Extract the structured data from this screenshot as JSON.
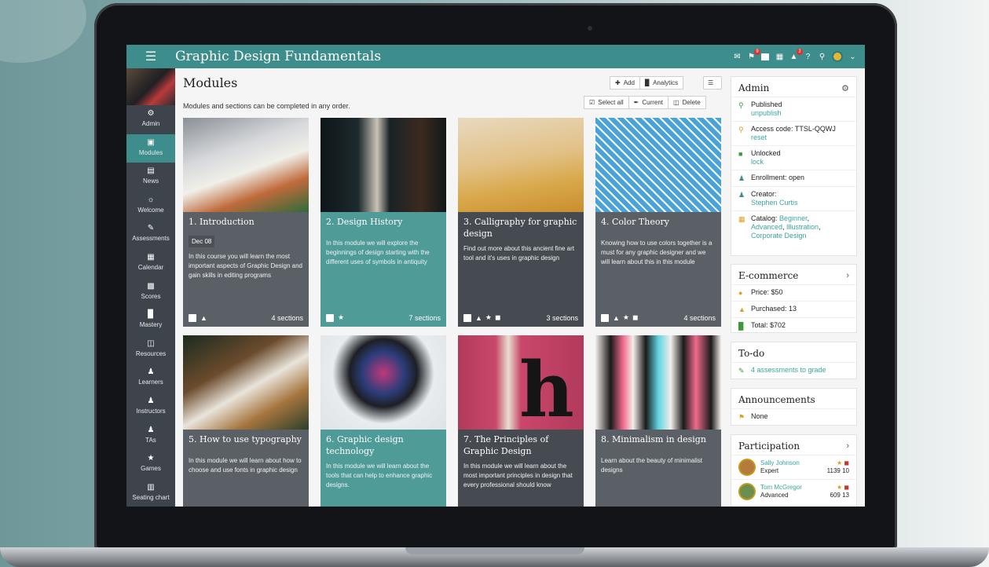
{
  "app": {
    "course_title": "Graphic Design Fundamentals"
  },
  "topbar": {
    "notification_badge": "9",
    "cart_badge": "2"
  },
  "sidebar": {
    "items": [
      {
        "label": "Admin",
        "icon": "gear-icon"
      },
      {
        "label": "Modules",
        "icon": "modules-icon",
        "active": true
      },
      {
        "label": "News",
        "icon": "news-icon"
      },
      {
        "label": "Welcome",
        "icon": "welcome-icon"
      },
      {
        "label": "Assessments",
        "icon": "assessments-icon"
      },
      {
        "label": "Calendar",
        "icon": "calendar-icon"
      },
      {
        "label": "Scores",
        "icon": "scores-icon"
      },
      {
        "label": "Mastery",
        "icon": "mastery-icon"
      },
      {
        "label": "Resources",
        "icon": "resources-icon"
      },
      {
        "label": "Learners",
        "icon": "learners-icon"
      },
      {
        "label": "Instructors",
        "icon": "instructors-icon"
      },
      {
        "label": "TAs",
        "icon": "tas-icon"
      },
      {
        "label": "Games",
        "icon": "trophy-icon"
      },
      {
        "label": "Seating chart",
        "icon": "seating-icon"
      }
    ]
  },
  "main": {
    "title": "Modules",
    "subtitle": "Modules and sections can be completed in any order.",
    "add_label": "Add",
    "analytics_label": "Analytics",
    "select_all_label": "Select all",
    "current_label": "Current",
    "delete_label": "Delete"
  },
  "modules": [
    {
      "title": "1. Introduction",
      "date": "Dec 08",
      "desc": "In this course you will learn the most important aspects of Graphic Design and gain skills in editing programs",
      "sections": "4 sections",
      "color": "#5b6067"
    },
    {
      "title": "2. Design History",
      "desc": "In this module we will explore the beginnings of design starting with the different uses of symbols in antiquity",
      "sections": "7 sections",
      "color": "#4f9b98"
    },
    {
      "title": "3. Calligraphy for graphic design",
      "desc": "Find out more about this ancient fine art tool and it's uses in graphic design",
      "sections": "3 sections",
      "color": "#464b52"
    },
    {
      "title": "4. Color Theory",
      "desc": "Knowing how to use colors together is a must for any graphic designer and we will learn about this in this module",
      "sections": "4 sections",
      "color": "#5b6067"
    },
    {
      "title": "5. How to use typography",
      "desc": "In this module we will learn about how to choose and use fonts in graphic design",
      "color": "#5b6067"
    },
    {
      "title": "6. Graphic design technology",
      "desc": "In this module we will learn about the tools that can help to enhance graphic designs.",
      "color": "#4f9b98"
    },
    {
      "title": "7. The Principles of Graphic Design",
      "desc": "In this module we will learn about the most important principles in design that every professional should know",
      "color": "#464b52"
    },
    {
      "title": "8. Minimalism in design",
      "desc": "Learn about the beauty of minimalist designs",
      "color": "#5b6067"
    }
  ],
  "admin": {
    "title": "Admin",
    "published": "Published",
    "unpublish": "unpublish",
    "access_code": "Access code: TTSL-QQWJ",
    "reset": "reset",
    "unlocked": "Unlocked",
    "lock": "lock",
    "enrollment": "Enrollment: open",
    "creator_label": "Creator:",
    "creator": "Stephen Curtis",
    "catalog_label": "Catalog:",
    "catalog_1": "Beginner",
    "catalog_2": "Advanced",
    "catalog_3": "Illustration",
    "catalog_4": "Corporate Design"
  },
  "ecommerce": {
    "title": "E-commerce",
    "price": "Price: $50",
    "purchased": "Purchased: 13",
    "total": "Total: $702"
  },
  "todo": {
    "title": "To-do",
    "item": "4 assessments to grade"
  },
  "announcements": {
    "title": "Announcements",
    "item": "None"
  },
  "participation": {
    "title": "Participation",
    "people": [
      {
        "name": "Sally Johnson",
        "level": "Expert",
        "points": "1139",
        "badges": "10"
      },
      {
        "name": "Tom McGregor",
        "level": "Advanced",
        "points": "609",
        "badges": "13"
      }
    ]
  }
}
